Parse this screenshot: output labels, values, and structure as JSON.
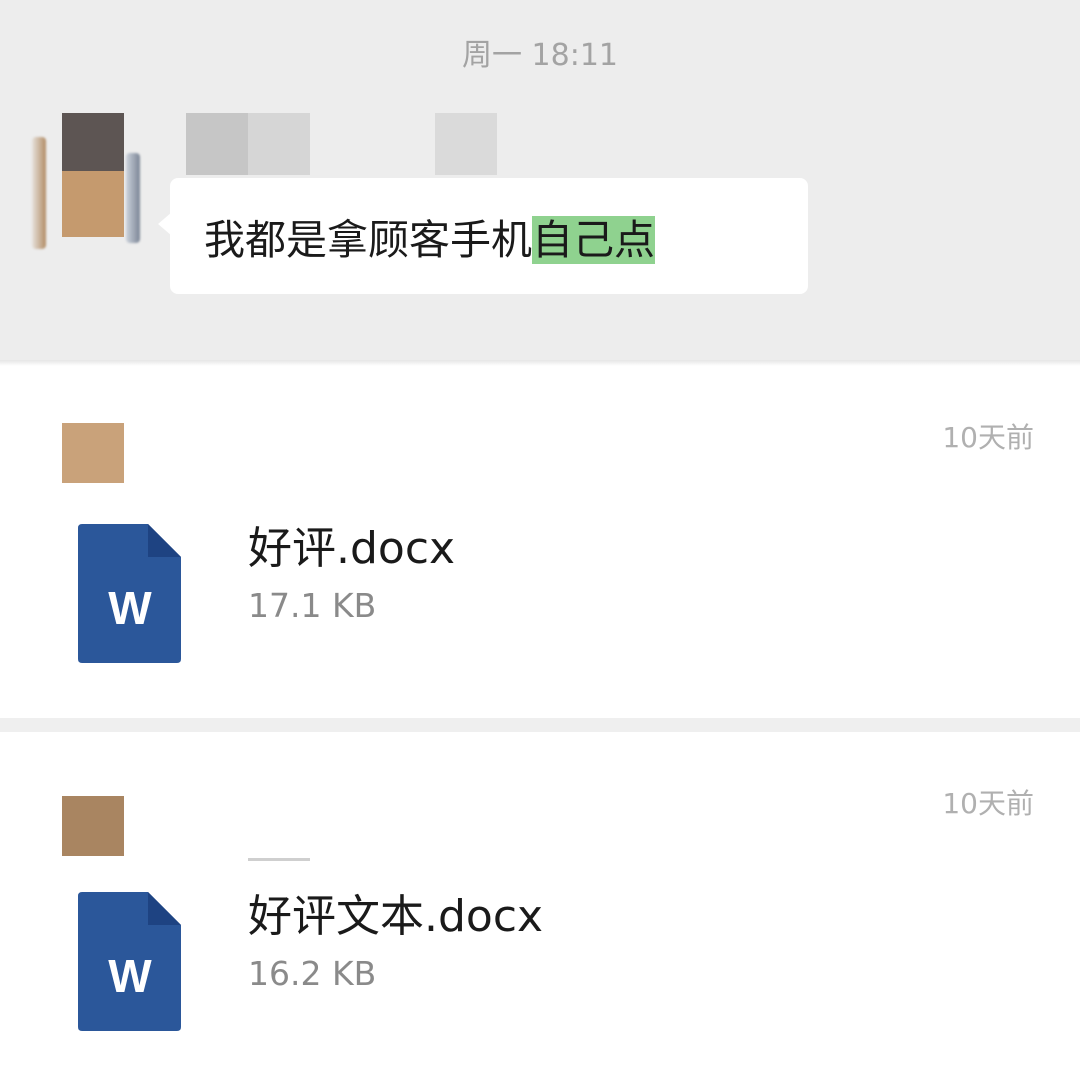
{
  "chat": {
    "timestamp": "周一 18:11",
    "message_plain": "我都是拿顾客手机",
    "message_highlight": "自己点",
    "highlight_color": "#8fd28f"
  },
  "files": [
    {
      "time_ago": "10天前",
      "name": "好评.docx",
      "size": "17.1 KB",
      "icon": "word-doc-icon",
      "icon_letter": "W"
    },
    {
      "time_ago": "10天前",
      "name": "好评文本.docx",
      "size": "16.2 KB",
      "icon": "word-doc-icon",
      "icon_letter": "W"
    }
  ],
  "colors": {
    "chat_background": "#ededed",
    "word_blue": "#2b579a",
    "word_fold": "#1e4382"
  }
}
